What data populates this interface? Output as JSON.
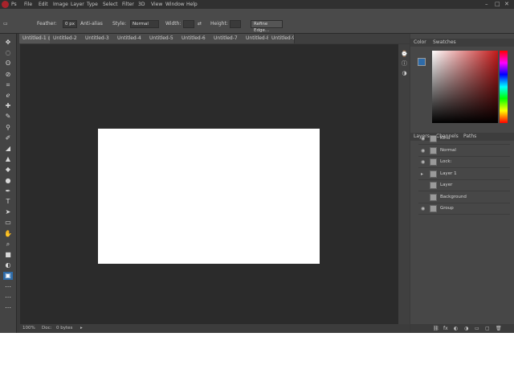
{
  "menubar": {
    "app_name": "Ps",
    "items": [
      "File",
      "Edit",
      "Image",
      "Layer",
      "Type",
      "Select",
      "Filter",
      "3D",
      "View",
      "Window",
      "Help"
    ],
    "window_controls": [
      "–",
      "□",
      "✕"
    ]
  },
  "options_bar": {
    "items": [
      "▭",
      "Feather:",
      "0 px",
      "Anti-alias",
      "Style:",
      "Normal",
      "Width:",
      "⇄",
      "Height:",
      "Refine Edge..."
    ]
  },
  "document": {
    "tabs": [
      "Untitled-1 @ 100% (RGB/8)",
      "Untitled-2",
      "Untitled-3",
      "Untitled-4",
      "Untitled-5",
      "Untitled-6",
      "Untitled-7",
      "Untitled-8",
      "Untitled-9"
    ],
    "status": [
      "100%",
      "Doc:",
      "0 bytes",
      "▸"
    ]
  },
  "toolbar": {
    "tools": [
      {
        "icon": "move-icon",
        "glyph": "✥"
      },
      {
        "icon": "marquee-icon",
        "glyph": "◌"
      },
      {
        "icon": "lasso-icon",
        "glyph": "ʘ"
      },
      {
        "icon": "quick-select-icon",
        "glyph": "⊘"
      },
      {
        "icon": "crop-icon",
        "glyph": "⌗"
      },
      {
        "icon": "eyedropper-icon",
        "glyph": "ℯ"
      },
      {
        "icon": "healing-icon",
        "glyph": "✚"
      },
      {
        "icon": "brush-icon",
        "glyph": "✎"
      },
      {
        "icon": "stamp-icon",
        "glyph": "⚲"
      },
      {
        "icon": "history-brush-icon",
        "glyph": "✐"
      },
      {
        "icon": "eraser-icon",
        "glyph": "◢"
      },
      {
        "icon": "gradient-icon",
        "glyph": "▲"
      },
      {
        "icon": "blur-icon",
        "glyph": "◆"
      },
      {
        "icon": "dodge-icon",
        "glyph": "●"
      },
      {
        "icon": "pen-icon",
        "glyph": "✒"
      },
      {
        "icon": "type-icon",
        "glyph": "T"
      },
      {
        "icon": "path-select-icon",
        "glyph": "➤"
      },
      {
        "icon": "shape-icon",
        "glyph": "▭"
      },
      {
        "icon": "hand-icon",
        "glyph": "✋"
      },
      {
        "icon": "zoom-icon",
        "glyph": "⌕"
      },
      {
        "icon": "swatch-foreground-icon",
        "glyph": "■"
      },
      {
        "icon": "quick-mask-icon",
        "glyph": "◐"
      },
      {
        "icon": "screen-mode-icon",
        "glyph": "▣",
        "selected": true
      },
      {
        "icon": "extra-tool-1-icon",
        "glyph": "⋯"
      },
      {
        "icon": "extra-tool-2-icon",
        "glyph": "⋯"
      },
      {
        "icon": "extra-tool-3-icon",
        "glyph": "⋯"
      }
    ]
  },
  "dock": {
    "icons": [
      {
        "icon": "history-panel-icon",
        "glyph": "⌚"
      },
      {
        "icon": "properties-panel-icon",
        "glyph": "ⓘ"
      },
      {
        "icon": "adjustments-panel-icon",
        "glyph": "◑"
      }
    ]
  },
  "color_panel": {
    "tabs": [
      "Color",
      "Swatches"
    ],
    "hue_color": "#c31a1a"
  },
  "layers_panel": {
    "tabs": [
      "Layers",
      "Channels",
      "Paths"
    ],
    "rows": [
      {
        "vis": "◉",
        "name": "Kind"
      },
      {
        "vis": "◉",
        "name": "Normal"
      },
      {
        "vis": "◉",
        "name": "Lock:"
      },
      {
        "vis": "▸",
        "name": "Layer 1"
      },
      {
        "vis": "",
        "name": "Layer"
      },
      {
        "vis": "",
        "name": "Background"
      },
      {
        "vis": "◉",
        "name": "Group"
      }
    ],
    "footer_icons": [
      "⛓",
      "fx",
      "◐",
      "◑",
      "▭",
      "▢",
      "🗑"
    ]
  }
}
